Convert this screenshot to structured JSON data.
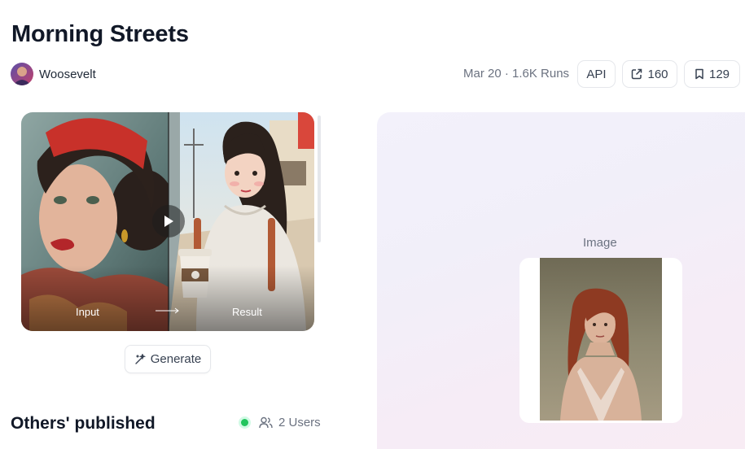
{
  "header": {
    "title": "Morning Streets",
    "author": {
      "name": "Woosevelt",
      "avatar_icon": "user-avatar"
    },
    "meta": "Mar 20 · 1.6K Runs",
    "api_label": "API",
    "share_count": "160",
    "save_count": "129"
  },
  "preview": {
    "input_label": "Input",
    "result_label": "Result",
    "play_icon": "play-icon"
  },
  "actions": {
    "generate_label": "Generate"
  },
  "others": {
    "title": "Others' published",
    "users_label": "2 Users",
    "status_color": "#22c55e"
  },
  "input_panel": {
    "image_label": "Image"
  }
}
